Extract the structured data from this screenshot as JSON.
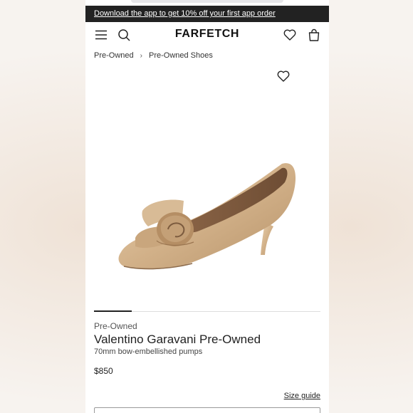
{
  "promo_banner": {
    "text": "Download the app to get 10% off your first app order"
  },
  "header": {
    "logo": "FARFETCH",
    "icons": [
      "menu-icon",
      "search-icon",
      "heart-icon",
      "bag-icon"
    ]
  },
  "breadcrumb": [
    "Pre-Owned",
    "Pre-Owned Shoes"
  ],
  "product": {
    "condition_label": "Pre-Owned",
    "brand": "Valentino Garavani Pre-Owned",
    "description": "70mm bow-embellished pumps",
    "price": "$850",
    "image_count_indicator": {
      "active_index": 0
    }
  },
  "size_guide_label": "Size guide",
  "colors": {
    "banner_bg": "#222222",
    "accent": "#222222",
    "shoe_gold": "#d4b48f"
  }
}
